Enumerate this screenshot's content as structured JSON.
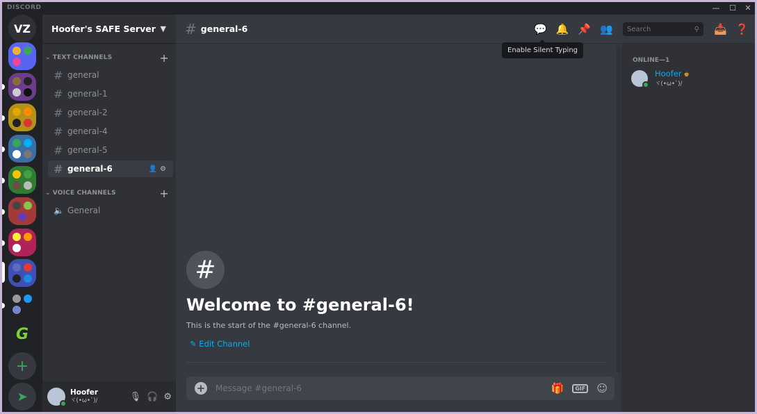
{
  "window": {
    "brand": "DISCORD"
  },
  "server": {
    "name": "Hoofer's SAFE Server"
  },
  "categories": {
    "text": "TEXT CHANNELS",
    "voice": "VOICE CHANNELS"
  },
  "text_channels": [
    "general",
    "general-1",
    "general-2",
    "general-4",
    "general-5",
    "general-6"
  ],
  "voice_channels": [
    "General"
  ],
  "active_channel": "general-6",
  "user": {
    "name": "Hoofer",
    "status": "ヾ(•ω•`)/"
  },
  "topbar": {
    "channel": "general-6",
    "tooltip": "Enable Silent Typing",
    "search_placeholder": "Search"
  },
  "welcome": {
    "title": "Welcome to #general-6!",
    "subtitle": "This is the start of the #general-6 channel.",
    "edit_label": "Edit Channel"
  },
  "composer": {
    "placeholder": "Message #general-6",
    "gif_label": "GIF"
  },
  "members": {
    "heading": "ONLINE—1",
    "list": [
      {
        "name": "Hoofer",
        "status": "ヾ(•ω•`)/"
      }
    ]
  },
  "colors": {
    "accent": "#00aff4",
    "online": "#3ba55d",
    "crown": "#faa61a"
  }
}
